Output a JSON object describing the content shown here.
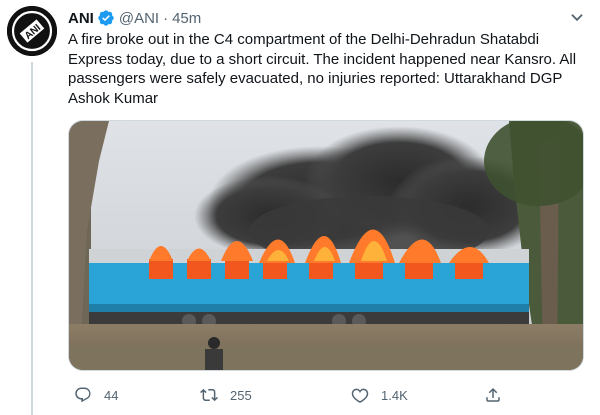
{
  "tweet": {
    "display_name": "ANI",
    "handle": "@ANI",
    "separator": "·",
    "time": "45m",
    "text": "A fire broke out in the C4 compartment of the Delhi-Dehradun Shatabdi Express today, due to a short circuit. The incident happened near Kansro. All passengers were safely evacuated, no injuries reported: Uttarakhand DGP Ashok Kumar",
    "avatar_logo_text": "ANI",
    "verified_icon": "verified-badge-icon",
    "more_icon": "more-chevron-icon",
    "media_description_icon": "burning-train-photo"
  },
  "actions": {
    "reply_count": "44",
    "retweet_count": "255",
    "like_count": "1.4K",
    "reply_icon": "reply-icon",
    "retweet_icon": "retweet-icon",
    "like_icon": "heart-icon",
    "share_icon": "share-icon"
  },
  "colors": {
    "text": "#0f1419",
    "muted": "#536471",
    "verified": "#1d9bf0",
    "border": "#cfd9de",
    "train_blue": "#2aa3d6",
    "fire": "#f2571e"
  }
}
